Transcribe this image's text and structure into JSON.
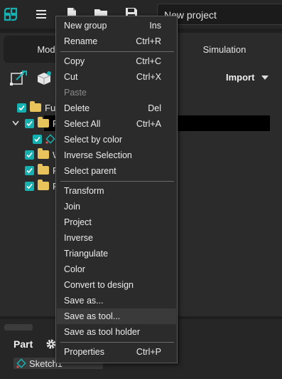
{
  "toolbar": {
    "icons": [
      "app-logo-icon",
      "hamburger-menu-icon",
      "new-file-icon",
      "open-folder-icon",
      "save-icon"
    ],
    "project_name": "New project"
  },
  "tabs": {
    "left_fragment": "Mod",
    "right": "Simulation"
  },
  "import": {
    "label": "Import"
  },
  "tree": {
    "rows": [
      {
        "label": "Ful"
      },
      {
        "label": "P"
      },
      {
        "label": ""
      },
      {
        "label": "W"
      },
      {
        "label": "F"
      },
      {
        "label": "R"
      }
    ]
  },
  "bottom": {
    "title": "Part",
    "item": "Sketch1"
  },
  "context_menu": {
    "items": [
      {
        "label": "New group",
        "shortcut": "Ins"
      },
      {
        "label": "Rename",
        "shortcut": "Ctrl+R"
      },
      {
        "label": "Copy",
        "shortcut": "Ctrl+C"
      },
      {
        "label": "Cut",
        "shortcut": "Ctrl+X"
      },
      {
        "label": "Paste",
        "shortcut": ""
      },
      {
        "label": "Delete",
        "shortcut": "Del"
      },
      {
        "label": "Select All",
        "shortcut": "Ctrl+A"
      },
      {
        "label": "Select by color",
        "shortcut": ""
      },
      {
        "label": "Inverse Selection",
        "shortcut": ""
      },
      {
        "label": "Select parent",
        "shortcut": ""
      },
      {
        "label": "Transform",
        "shortcut": ""
      },
      {
        "label": "Join",
        "shortcut": ""
      },
      {
        "label": "Project",
        "shortcut": ""
      },
      {
        "label": "Inverse",
        "shortcut": ""
      },
      {
        "label": "Triangulate",
        "shortcut": ""
      },
      {
        "label": "Color",
        "shortcut": ""
      },
      {
        "label": "Convert to design",
        "shortcut": ""
      },
      {
        "label": "Save as...",
        "shortcut": ""
      },
      {
        "label": "Save as tool...",
        "shortcut": ""
      },
      {
        "label": "Save as tool holder",
        "shortcut": ""
      },
      {
        "label": "Properties",
        "shortcut": "Ctrl+P"
      }
    ],
    "disabled_items": [
      "Paste"
    ],
    "highlighted_item": "Save as tool..."
  },
  "colors": {
    "accent": "#17b0b0",
    "folder": "#e8c25a",
    "menu_bg": "#2b2b2b",
    "background": "#1e1e1e"
  }
}
